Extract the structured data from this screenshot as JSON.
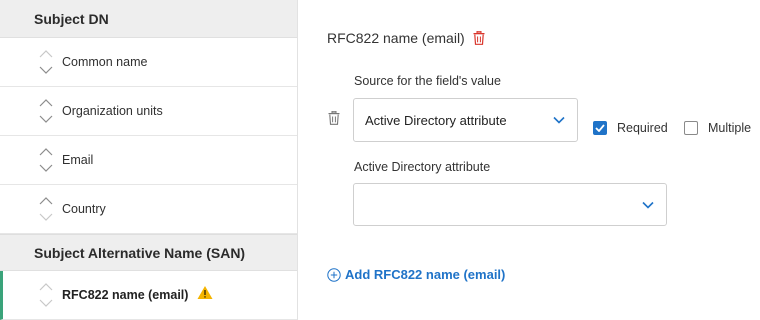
{
  "left_panel": {
    "subject_dn": {
      "header": "Subject DN",
      "items": [
        {
          "label": "Common name"
        },
        {
          "label": "Organization units"
        },
        {
          "label": "Email"
        },
        {
          "label": "Country"
        }
      ]
    },
    "san": {
      "header": "Subject Alternative Name (SAN)",
      "items": [
        {
          "label": "RFC822 name (email)",
          "selected": true,
          "warning": true
        }
      ]
    }
  },
  "right_panel": {
    "title": "RFC822 name (email)",
    "source_label": "Source for the field's value",
    "source_value": "Active Directory attribute",
    "ad_attribute_label": "Active Directory attribute",
    "ad_attribute_value": "",
    "required_label": "Required",
    "required_checked": true,
    "multiple_label": "Multiple",
    "multiple_checked": false,
    "add_link": "Add RFC822 name (email)"
  },
  "colors": {
    "accent_blue": "#1f73c8",
    "delete_red": "#d9352b",
    "warning_yellow": "#f4b400",
    "selected_bar_green": "#3aa37a",
    "header_bg": "#eeeeee"
  },
  "icons": {
    "sort": "sort-arrows-icon",
    "warning": "warning-icon",
    "delete": "trash-icon",
    "dropdown": "chevron-down-icon",
    "add": "plus-circle-icon",
    "check": "checkmark-icon"
  }
}
